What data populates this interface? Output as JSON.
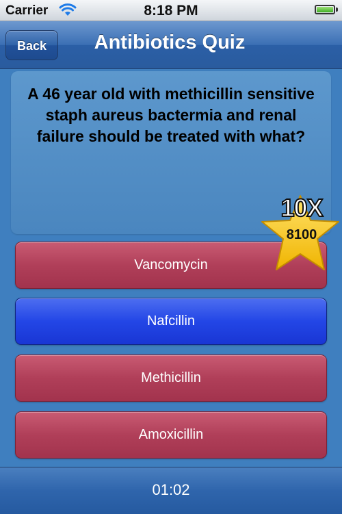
{
  "status_bar": {
    "carrier": "Carrier",
    "time": "8:18 PM",
    "wifi_icon": "wifi-icon",
    "battery_icon": "battery-icon"
  },
  "nav": {
    "back_label": "Back",
    "title": "Antibiotics Quiz"
  },
  "question": {
    "text": "A 46 year old with methicillin sensitive staph aureus bactermia and renal failure should be treated with what?"
  },
  "answers": [
    {
      "label": "Vancomycin",
      "selected": false
    },
    {
      "label": "Nafcillin",
      "selected": true
    },
    {
      "label": "Methicillin",
      "selected": false
    },
    {
      "label": "Amoxicillin",
      "selected": false
    }
  ],
  "score_badge": {
    "multiplier": "10X",
    "score": "8100",
    "icon": "star-icon"
  },
  "timer": "01:02",
  "colors": {
    "background": "#3f7fbf",
    "answer_default": "#b03f59",
    "answer_selected": "#2346e6",
    "star": "#f5c61c"
  }
}
